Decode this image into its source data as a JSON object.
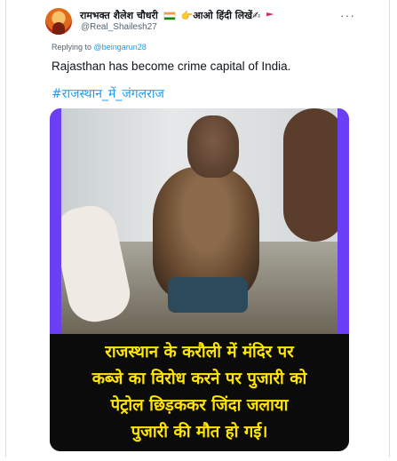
{
  "tweet": {
    "display_name": "रामभक्त शैलेश चौधरी",
    "name_suffix": "👉आओ हिंदी लिखें✍",
    "handle": "@Real_Shailesh27",
    "more_label": "···",
    "replying_prefix": "Replying to",
    "replying_to": "@beingarun28",
    "text": "Rajasthan has become crime capital of India.",
    "hashtag": "#राजस्थान_में_जंगलराज",
    "media": {
      "caption_lines": [
        "राजस्थान के करौली में मंदिर पर",
        "कब्जे का विरोध करने पर पुजारी को",
        "पेट्रोल छिड़ककर जिंदा जलाया",
        "पुजारी की मौत हो गई।"
      ]
    }
  },
  "colors": {
    "link": "#1d9bf0",
    "secondary_text": "#536471",
    "media_border": "#6a3ff5",
    "caption_text": "#ffe600",
    "caption_background": "#0b0b0b"
  }
}
